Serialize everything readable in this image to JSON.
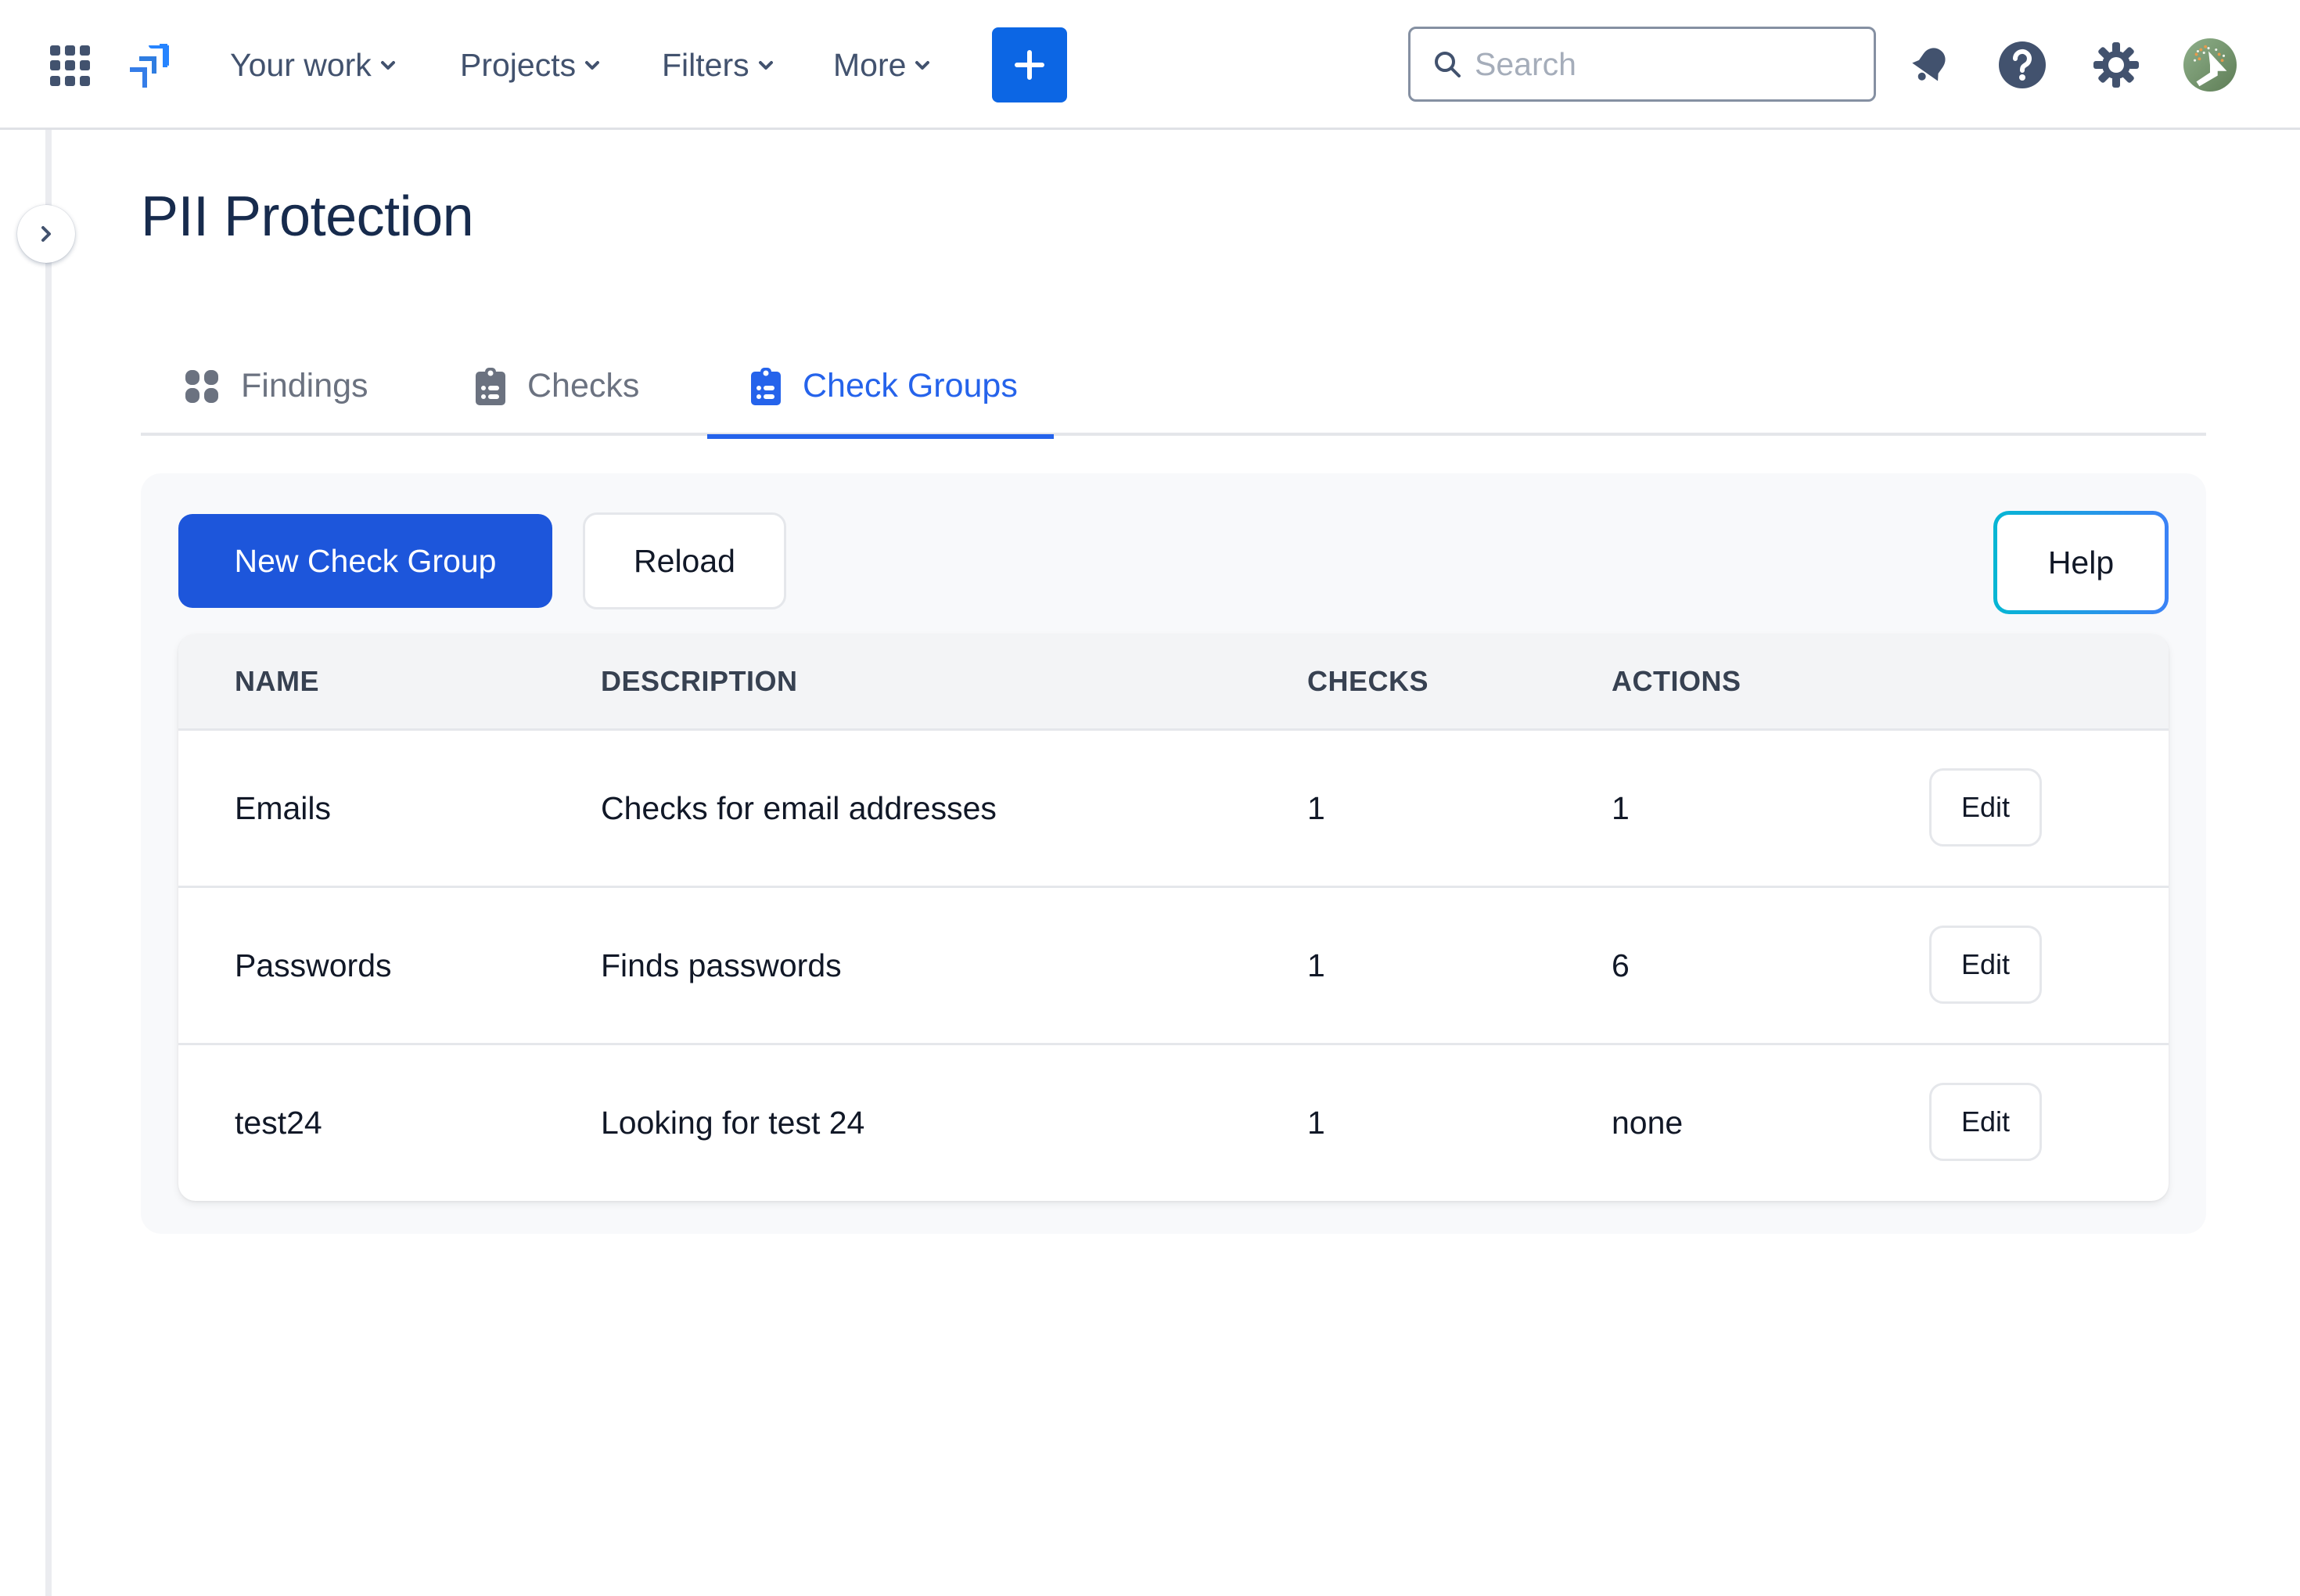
{
  "topbar": {
    "nav": [
      {
        "label": "Your work"
      },
      {
        "label": "Projects"
      },
      {
        "label": "Filters"
      },
      {
        "label": "More"
      }
    ],
    "search": {
      "placeholder": "Search",
      "value": ""
    },
    "icons": {
      "apps": "app-switcher-grid",
      "logo": "jira-logo",
      "create": "plus",
      "notifications": "bell",
      "help": "question-circle",
      "settings": "gear",
      "avatar": "user-avatar"
    },
    "colors": {
      "create_bg": "#0c66e4",
      "icon": "#42526e"
    }
  },
  "page": {
    "title": "PII Protection"
  },
  "tabs": [
    {
      "label": "Findings",
      "icon": "grid-four",
      "active": false
    },
    {
      "label": "Checks",
      "icon": "clipboard-list",
      "active": false
    },
    {
      "label": "Check Groups",
      "icon": "clipboard-list",
      "active": true
    }
  ],
  "toolbar": {
    "new_label": "New Check Group",
    "reload_label": "Reload",
    "help_label": "Help"
  },
  "table": {
    "headers": [
      "NAME",
      "DESCRIPTION",
      "CHECKS",
      "ACTIONS"
    ],
    "rows": [
      {
        "name": "Emails",
        "description": "Checks for email addresses",
        "checks": "1",
        "actions": "1",
        "edit_label": "Edit"
      },
      {
        "name": "Passwords",
        "description": "Finds passwords",
        "checks": "1",
        "actions": "6",
        "edit_label": "Edit"
      },
      {
        "name": "test24",
        "description": "Looking for test 24",
        "checks": "1",
        "actions": "none",
        "edit_label": "Edit"
      }
    ]
  },
  "colors": {
    "accent": "#2563eb",
    "primary_button": "#1d56db",
    "title": "#172b4d",
    "tab_inactive": "#6b7280",
    "help_gradient_start": "#06b6d4",
    "help_gradient_end": "#3b82f6"
  }
}
